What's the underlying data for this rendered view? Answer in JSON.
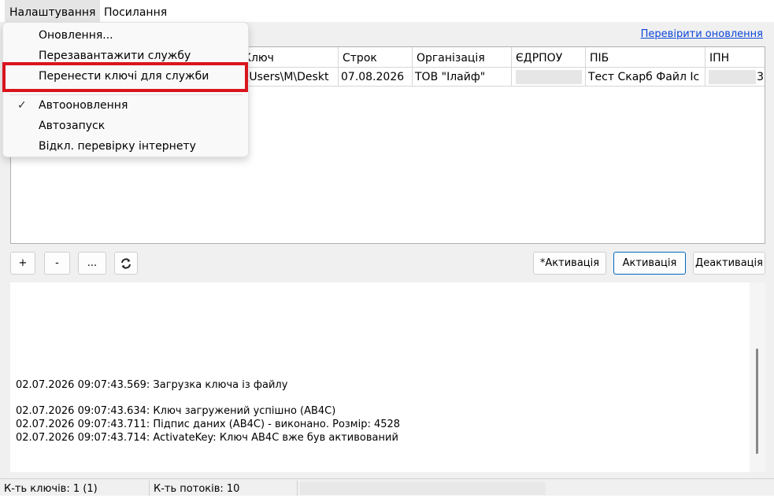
{
  "menubar": {
    "settings": "Налаштування",
    "links": "Посилання"
  },
  "check_updates_link": "Перевірити оновлення",
  "grid": {
    "columns": [
      "Ключ",
      "Строк",
      "Організація",
      "ЄДРПОУ",
      "ПІБ",
      "ІПН"
    ],
    "row": {
      "key": ":\\Users\\M\\Deskt",
      "expiry": "07.08.2026",
      "organization": "ТОВ \"Ілайф\"",
      "pib": "Тест Скарб Файл Іс",
      "ipn_tail": "3"
    }
  },
  "toolbar": {
    "add": "+",
    "remove": "-",
    "more": "...",
    "refresh_icon": "refresh-icon"
  },
  "actions": {
    "star_activate": "*Активація",
    "activate": "Активація",
    "deactivate": "Деактивація"
  },
  "log": [
    "02.07.2026 09:07:43.569: Загрузка ключа із файлу",
    "02.07.2026 09:07:43.634: Ключ загружений успішно (AB4C)",
    "02.07.2026 09:07:43.711: Підпис даних (AB4C) - виконано. Розмір: 4528",
    "02.07.2026 09:07:43.714: ActivateKey: Ключ AB4C вже був активований"
  ],
  "status": {
    "keys": "К-ть ключів: 1 (1)",
    "threads": "К-ть потоків: 10"
  },
  "menu": {
    "items": [
      {
        "label": "Оновлення..."
      },
      {
        "label": "Перезавантажити службу"
      },
      {
        "label": "Перенести ключі для служби",
        "highlighted": true
      },
      {
        "label": "Автооновлення",
        "checked": true
      },
      {
        "label": "Автозапуск"
      },
      {
        "label": "Відкл. перевірку інтернету"
      }
    ],
    "check_mark": "✓"
  },
  "colors": {
    "highlight": "#d9141d",
    "link": "#0b45d8",
    "primary_border": "#0067c0"
  }
}
